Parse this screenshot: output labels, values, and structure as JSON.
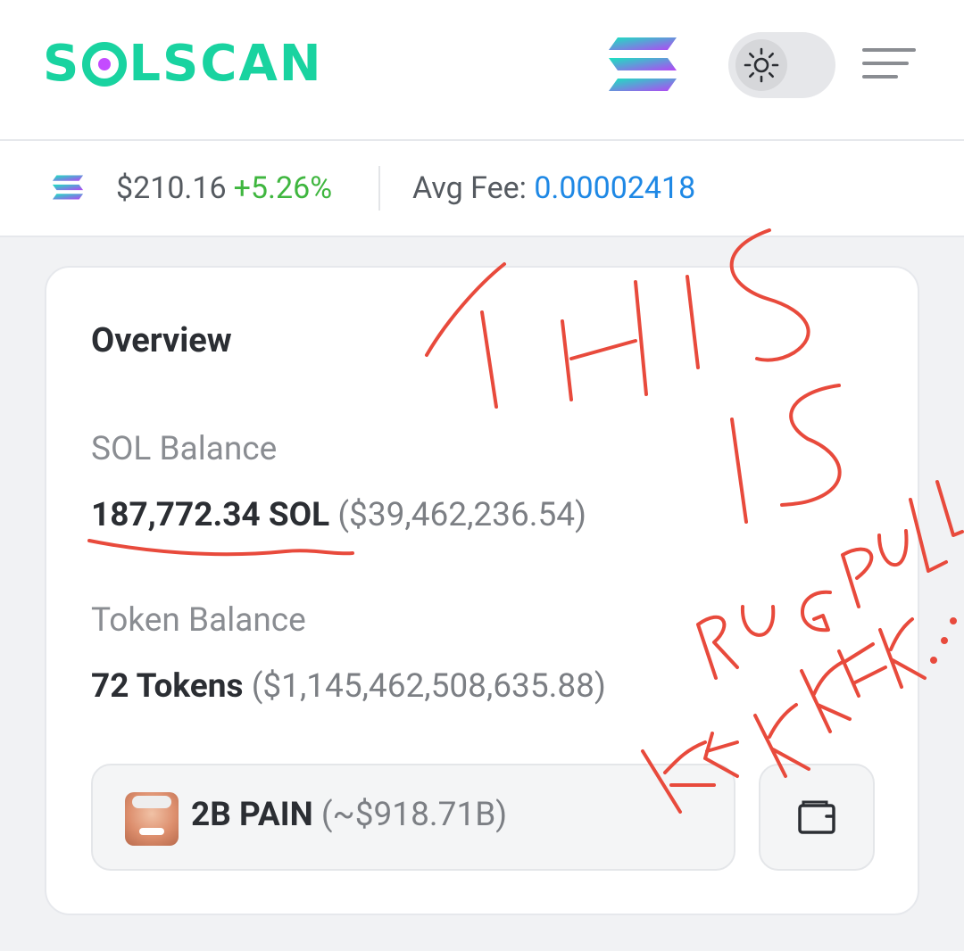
{
  "header": {
    "logo_text_before": "S",
    "logo_text_after": "LSCAN",
    "icons": [
      "solana-logo-icon",
      "sun-icon",
      "hamburger-menu-icon"
    ]
  },
  "price_bar": {
    "price": "$210.16",
    "change": "+5.26%",
    "fee_label": "Avg Fee:",
    "fee_value": "0.00002418"
  },
  "overview": {
    "title": "Overview",
    "sol_balance_label": "SOL Balance",
    "sol_balance_value": "187,772.34 SOL",
    "sol_balance_usd": "($39,462,236.54)",
    "token_balance_label": "Token Balance",
    "token_balance_value": "72 Tokens",
    "token_balance_usd": "($1,145,462,508,635.88)",
    "selected_token": {
      "name": "2B PAIN",
      "usd": "(~$918.71B)"
    }
  },
  "annotation": {
    "handwritten": [
      "THIS",
      "IS",
      "RUG PULL",
      "KEK KEK..."
    ],
    "color": "#e84a3c"
  },
  "colors": {
    "brand_green": "#19d3a0",
    "price_up": "#3fb63f",
    "fee_blue": "#1e88e5"
  }
}
